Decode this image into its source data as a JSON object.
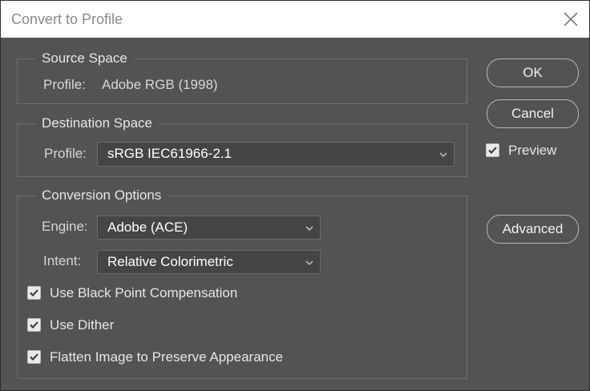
{
  "window": {
    "title": "Convert to Profile"
  },
  "source_space": {
    "legend": "Source Space",
    "profile_label": "Profile:",
    "profile_value": "Adobe RGB (1998)"
  },
  "destination_space": {
    "legend": "Destination Space",
    "profile_label": "Profile:",
    "profile_value": "sRGB IEC61966-2.1"
  },
  "conversion_options": {
    "legend": "Conversion Options",
    "engine_label": "Engine:",
    "engine_value": "Adobe (ACE)",
    "intent_label": "Intent:",
    "intent_value": "Relative Colorimetric",
    "checkboxes": [
      {
        "label": "Use Black Point Compensation",
        "checked": true
      },
      {
        "label": "Use Dither",
        "checked": true
      },
      {
        "label": "Flatten Image to Preserve Appearance",
        "checked": true
      }
    ]
  },
  "buttons": {
    "ok": "OK",
    "cancel": "Cancel",
    "advanced": "Advanced"
  },
  "preview": {
    "label": "Preview",
    "checked": true
  },
  "icons": {
    "close": "close-icon",
    "dropdown": "chevron-down-icon",
    "check": "checkmark-icon"
  },
  "colors": {
    "dialog_bg": "#535353",
    "titlebar_bg": "#ffffff",
    "field_bg": "#454545"
  }
}
